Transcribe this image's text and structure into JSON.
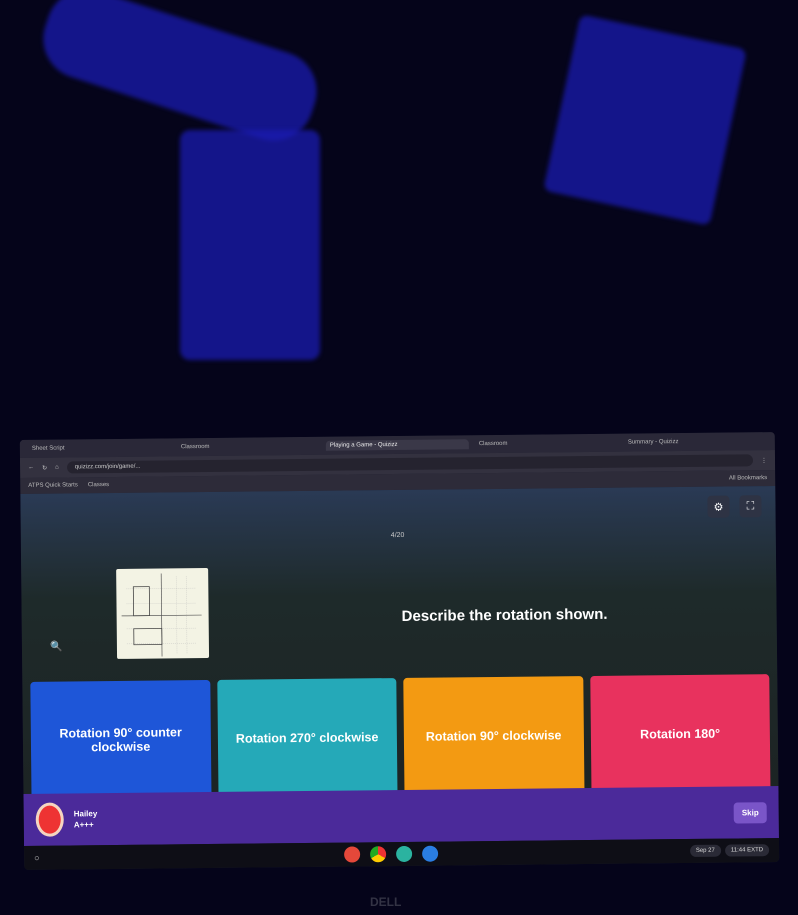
{
  "browser": {
    "tabs": [
      "Sheet Script",
      "Classroom",
      "Playing a Game - Quizizz",
      "Classroom",
      "Summary - Quizizz"
    ],
    "url": "quizizz.com/join/game/...",
    "bookmarks": [
      "ATPS Quick Starts",
      "Classes"
    ],
    "all_bookmarks": "All Bookmarks"
  },
  "quiz": {
    "counter": "4/20",
    "question": "Describe the rotation shown.",
    "options": [
      {
        "label": "Rotation 90° counter clockwise",
        "color": "#1e56d8"
      },
      {
        "label": "Rotation 270° clockwise",
        "color": "#25a9b8"
      },
      {
        "label": "Rotation 90° clockwise",
        "color": "#f39a12"
      },
      {
        "label": "Rotation 180°",
        "color": "#e8325e"
      }
    ],
    "player": {
      "name": "Hailey",
      "rank": "A+++"
    },
    "skip": "Skip"
  },
  "shelf": {
    "date": "Sep 27",
    "time": "11:44 EXTD"
  },
  "brand": "DELL"
}
